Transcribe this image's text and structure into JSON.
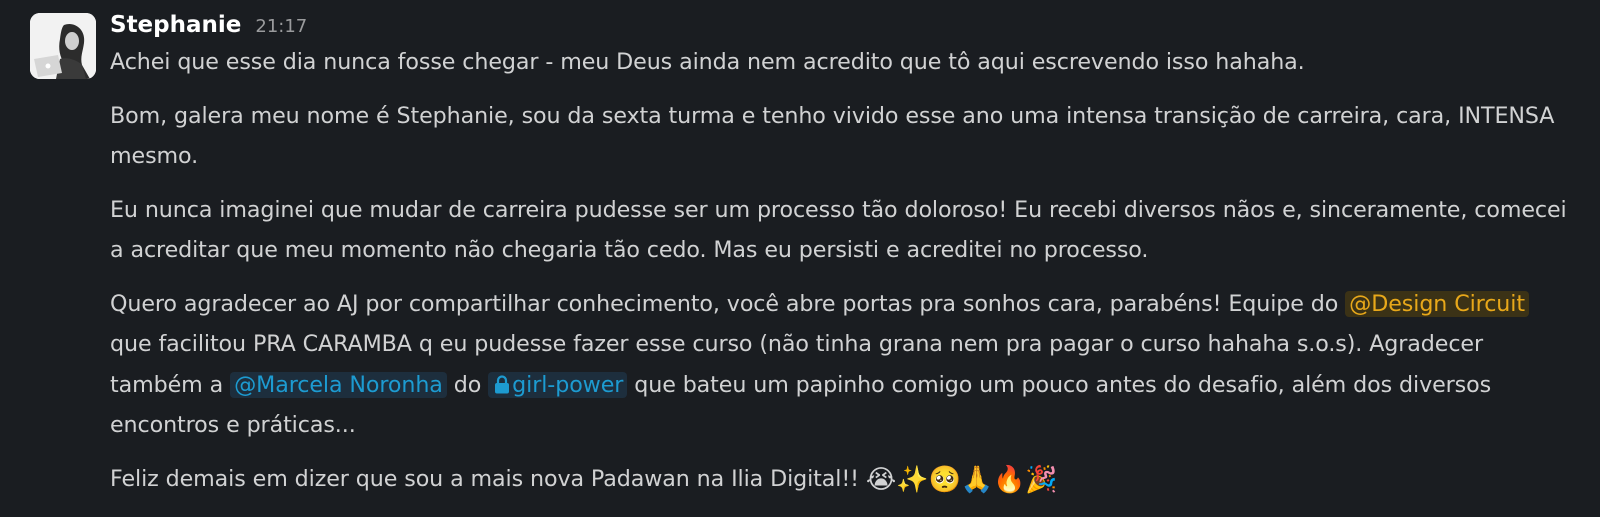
{
  "message": {
    "sender": "Stephanie",
    "time": "21:17",
    "p1": "Achei que esse dia nunca fosse chegar - meu Deus ainda nem acredito que tô aqui escrevendo isso hahaha.",
    "p2": "Bom, galera meu nome é Stephanie, sou da sexta turma e tenho vivido esse ano uma intensa transição de carreira, cara, INTENSA mesmo.",
    "p3": "Eu nunca imaginei que mudar de carreira pudesse ser um processo tão doloroso! Eu recebi diversos nãos e, sinceramente, comecei a acreditar que meu momento não chegaria tão cedo. Mas eu persisti e acreditei no processo.",
    "p4_a": "Quero agradecer ao AJ por compartilhar conhecimento, você abre portas pra sonhos cara, parabéns! Equipe do ",
    "mention_group": "@Design Circuit",
    "p4_b": " que facilitou PRA CARAMBA q eu pudesse fazer esse curso (não tinha grana nem pra pagar o curso hahaha s.o.s). Agradecer também a ",
    "mention_user": "@Marcela Noronha",
    "p4_c": " do ",
    "channel": "girl-power",
    "p4_d": " que bateu um papinho comigo um pouco antes do desafio, além dos diversos encontros e práticas...",
    "p5": "Feliz demais em dizer que sou a mais nova Padawan na Ilia Digital!! ",
    "emojis": [
      "😭",
      "✨",
      "🥺",
      "🙏",
      "🔥",
      "🎉"
    ]
  },
  "colors": {
    "background": "#1a1d21",
    "text": "#d1d2d3",
    "mention_group": "#e8a81a",
    "mention_user": "#1d9bd1"
  }
}
